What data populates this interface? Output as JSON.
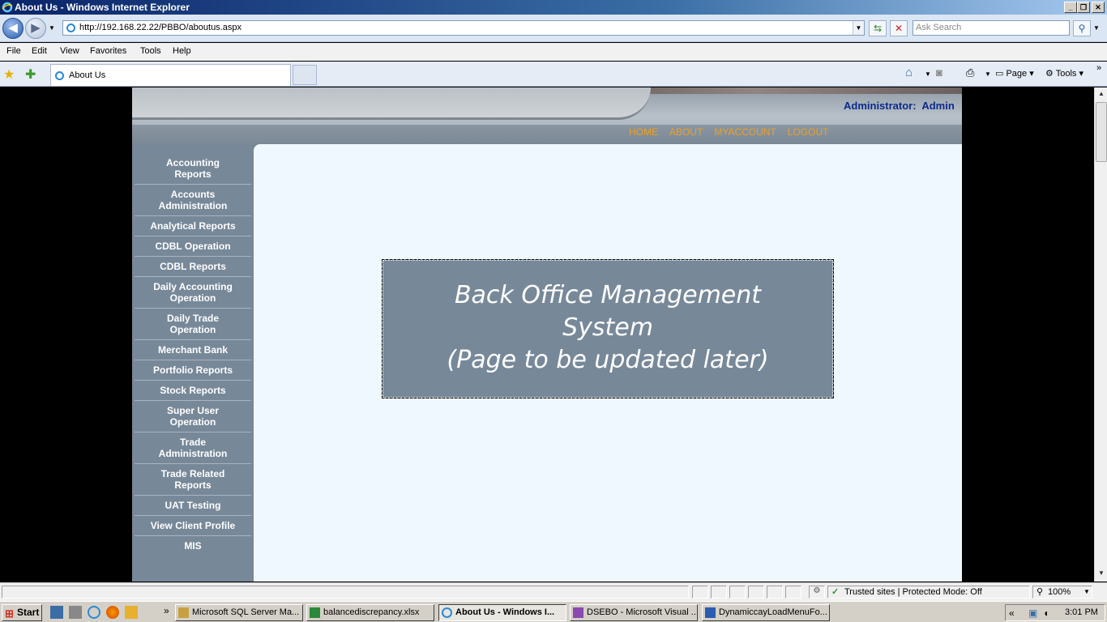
{
  "window": {
    "title": "About Us - Windows Internet Explorer"
  },
  "address": {
    "url": "http://192.168.22.22/PBBO/aboutus.aspx",
    "search_placeholder": "Ask Search"
  },
  "menu": {
    "items": [
      "File",
      "Edit",
      "View",
      "Favorites",
      "Tools",
      "Help"
    ]
  },
  "tabs": {
    "active": "About Us"
  },
  "toolbar": {
    "page_label": "Page",
    "tools_label": "Tools"
  },
  "site": {
    "admin_label": "Administrator:",
    "admin_name": "Admin",
    "nav": [
      "HOME",
      "ABOUT",
      "MYACCOUNT",
      "LOGOUT"
    ],
    "sidebar": [
      {
        "label": "Accounting\nReports"
      },
      {
        "label": "Accounts\nAdministration"
      },
      {
        "label": "Analytical Reports"
      },
      {
        "label": "CDBL Operation"
      },
      {
        "label": "CDBL Reports"
      },
      {
        "label": "Daily Accounting\nOperation"
      },
      {
        "label": "Daily Trade\nOperation"
      },
      {
        "label": "Merchant Bank"
      },
      {
        "label": "Portfolio Reports"
      },
      {
        "label": "Stock Reports"
      },
      {
        "label": "Super User\nOperation"
      },
      {
        "label": "Trade\nAdministration"
      },
      {
        "label": "Trade Related\nReports"
      },
      {
        "label": "UAT Testing"
      },
      {
        "label": "View Client Profile"
      },
      {
        "label": "MIS"
      }
    ],
    "message": {
      "line1": "Back Office Management",
      "line2": "System",
      "line3": "(Page to be updated later)"
    }
  },
  "status": {
    "zone": "Trusted sites | Protected Mode: Off",
    "zoom": "100%"
  },
  "taskbar": {
    "start": "Start",
    "tasks": [
      {
        "label": "Microsoft SQL Server Ma..."
      },
      {
        "label": "balancediscrepancy.xlsx"
      },
      {
        "label": "About Us - Windows I..."
      },
      {
        "label": "DSEBO - Microsoft Visual ..."
      },
      {
        "label": "DynamiccayLoadMenuFo..."
      }
    ],
    "clock": "3:01 PM"
  },
  "colors": {
    "site_bg": "#778899",
    "main_bg": "#f0f8ff",
    "nav_orange": "#f0a020",
    "admin_blue": "#0b2a8a"
  }
}
